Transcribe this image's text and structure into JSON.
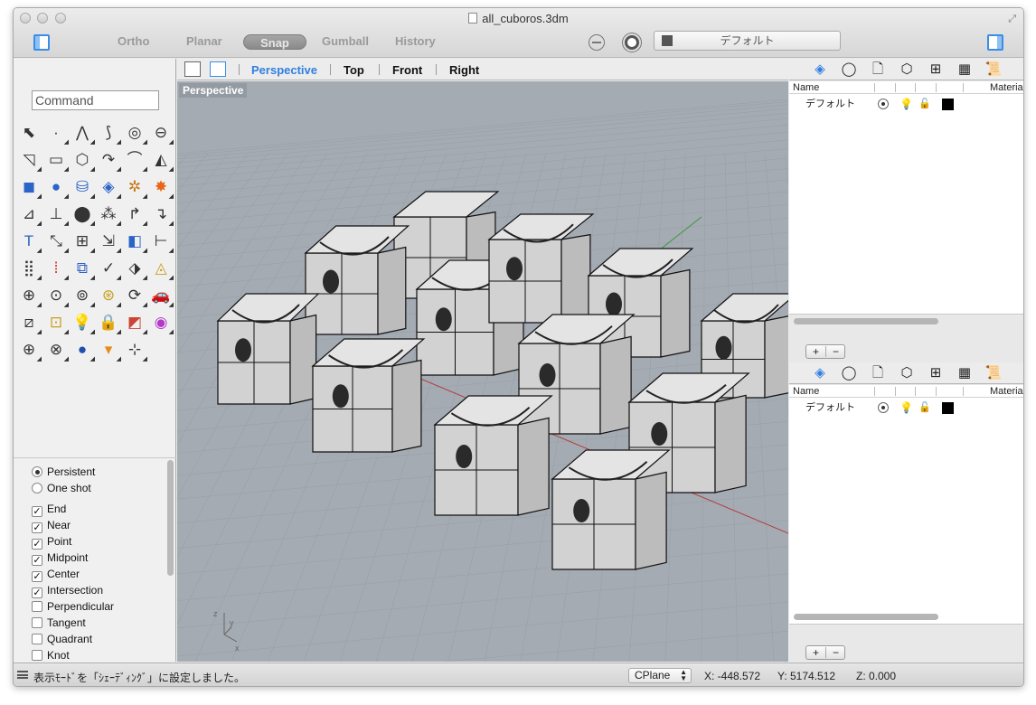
{
  "window": {
    "title": "all_cuboros.3dm"
  },
  "toolbar": {
    "modes": [
      {
        "label": "Ortho"
      },
      {
        "label": "Planar"
      },
      {
        "label": "Snap"
      },
      {
        "label": "Gumball"
      },
      {
        "label": "History"
      }
    ],
    "layer_select": "デフォルト"
  },
  "left": {
    "command_placeholder": "Command",
    "osnap_mode": [
      {
        "label": "Persistent",
        "selected": true
      },
      {
        "label": "One shot",
        "selected": false
      }
    ],
    "osnaps": [
      {
        "label": "End",
        "checked": true
      },
      {
        "label": "Near",
        "checked": true
      },
      {
        "label": "Point",
        "checked": true
      },
      {
        "label": "Midpoint",
        "checked": true
      },
      {
        "label": "Center",
        "checked": true
      },
      {
        "label": "Intersection",
        "checked": true
      },
      {
        "label": "Perpendicular",
        "checked": false
      },
      {
        "label": "Tangent",
        "checked": false
      },
      {
        "label": "Quadrant",
        "checked": false
      },
      {
        "label": "Knot",
        "checked": false
      }
    ]
  },
  "viewport": {
    "tabs": [
      "Perspective",
      "Top",
      "Front",
      "Right"
    ],
    "active_tab": "Perspective",
    "label": "Perspective",
    "axis": {
      "x": "x",
      "y": "y",
      "z": "z"
    }
  },
  "layers": {
    "columns": {
      "name": "Name",
      "material": "Materia"
    },
    "rows": [
      {
        "name": "デフォルト",
        "color": "#000000"
      }
    ],
    "add_label": "+",
    "remove_label": "−"
  },
  "status": {
    "message": "表示ﾓｰﾄﾞを「ｼｪｰﾃﾞｨﾝｸﾞ」に設定しました。",
    "cplane": "CPlane",
    "x": "X: -448.572",
    "y": "Y: 5174.512",
    "z": "Z: 0.000"
  }
}
